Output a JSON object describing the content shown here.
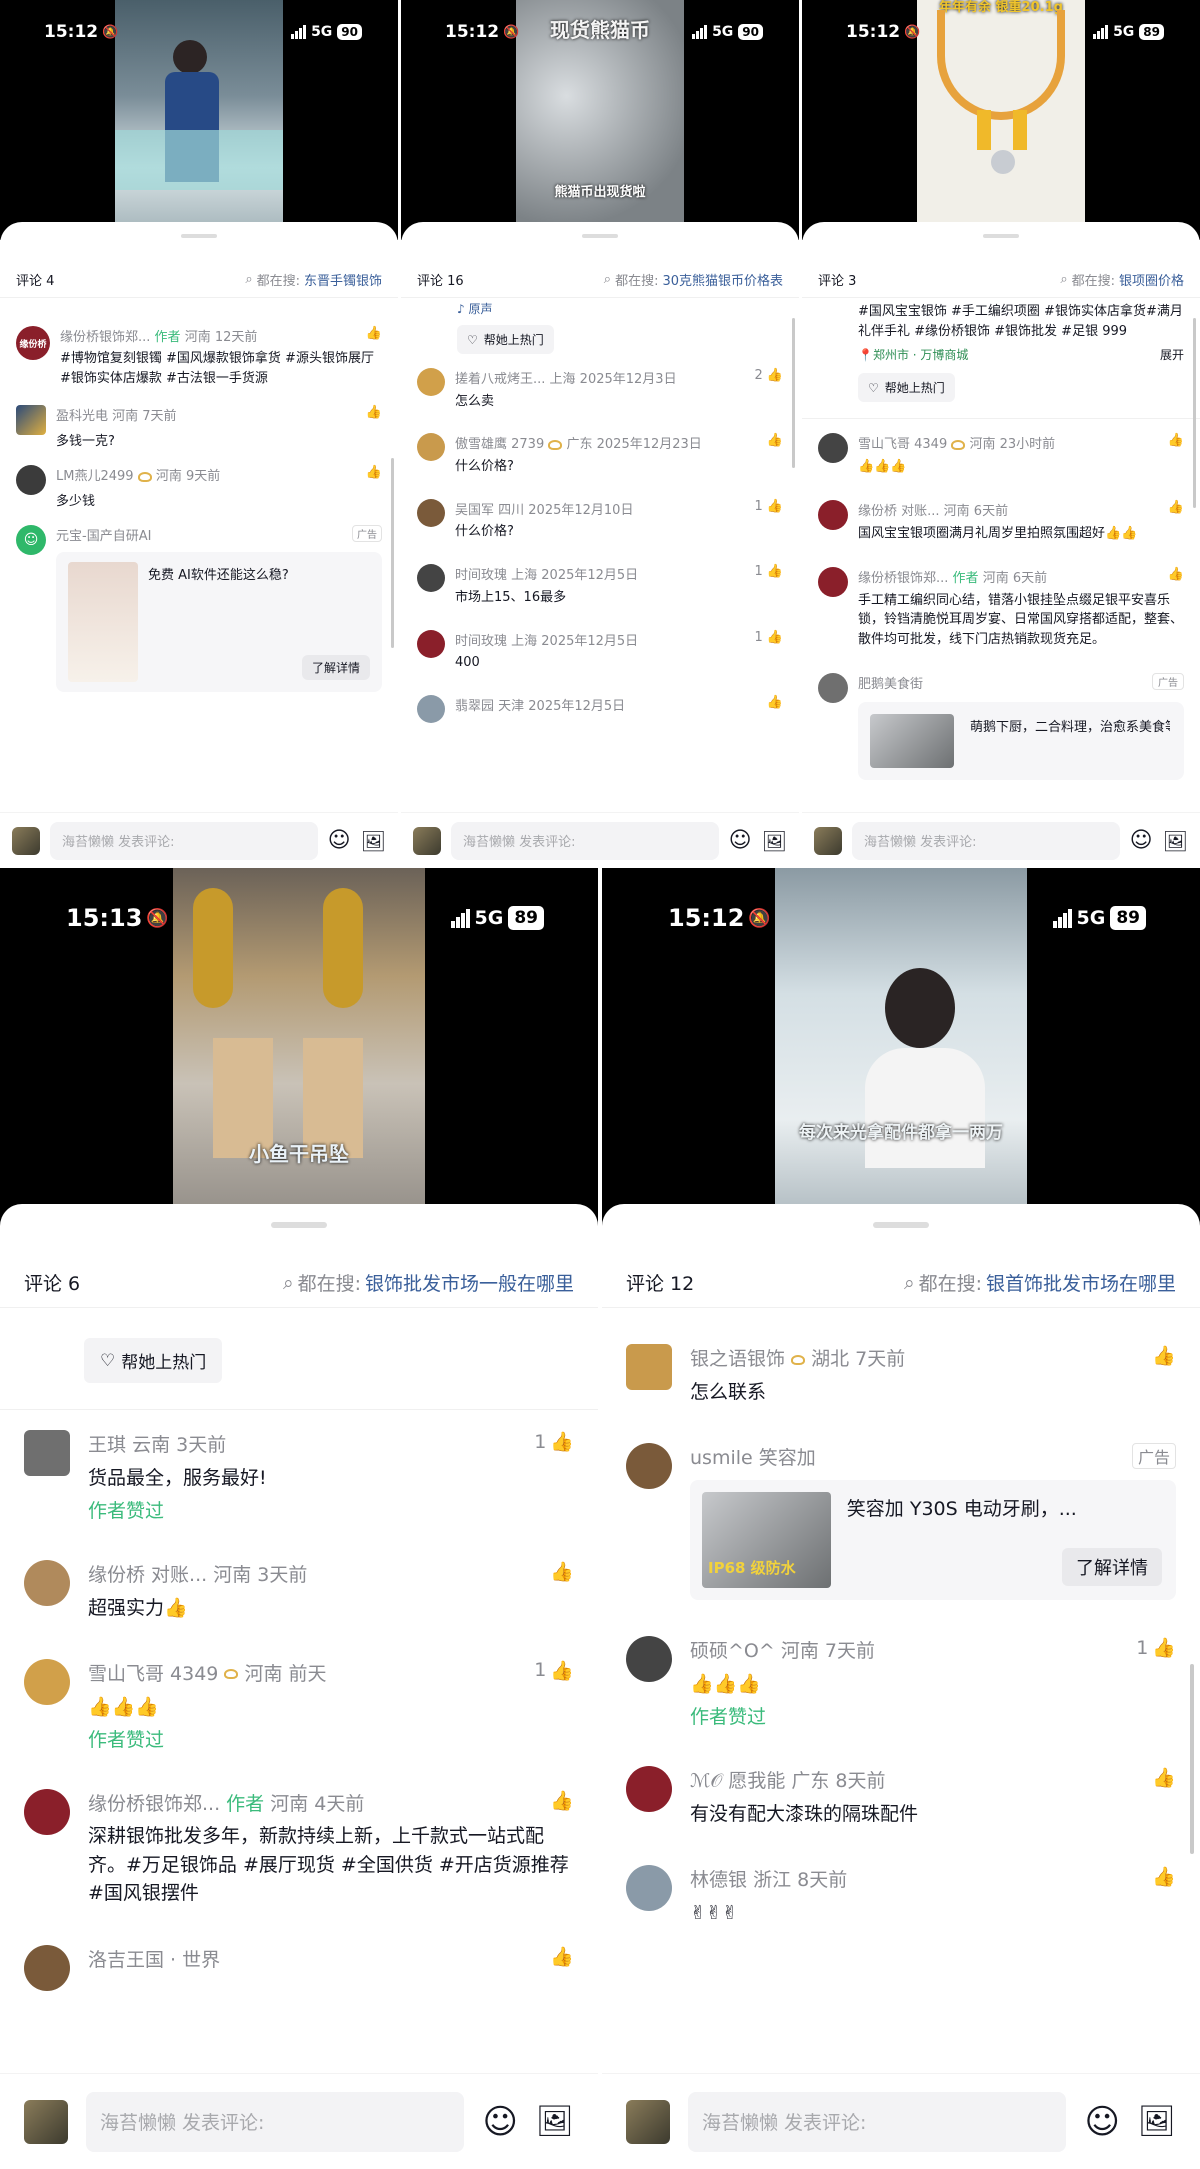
{
  "panels": [
    {
      "time": "15:12",
      "network": "5G",
      "battery": "90",
      "video_caption": "",
      "count": "评论 4",
      "search_prefix": "都在搜:",
      "search_term": "东晋手镯银饰",
      "items": [
        {
          "kind": "comment",
          "name": "缘份桥银饰郑...",
          "author_tag": "作者",
          "meta": "河南 12天前",
          "text": "#博物馆复刻银镯 #国风爆款银饰拿货 #源头银饰展厅 #银饰实体店爆款 #古法银一手货源",
          "likes": "",
          "liked_by": ""
        },
        {
          "kind": "comment",
          "name": "盈科光电",
          "author_tag": "",
          "meta": "河南 7天前",
          "text": "多钱一克?",
          "likes": "",
          "liked_by": ""
        },
        {
          "kind": "comment",
          "name": "LM燕儿2499",
          "author_tag": "",
          "meta": "河南 9天前",
          "text": "多少钱",
          "likes": "",
          "liked_by": ""
        },
        {
          "kind": "ad",
          "name": "元宝-国产自研AI",
          "ad_label": "广告",
          "title": "免费 AI软件还能这么稳?",
          "button": "了解详情"
        }
      ],
      "input_placeholder": "海苔懒懒 发表评论:"
    },
    {
      "time": "15:12",
      "network": "5G",
      "battery": "90",
      "video_title": "现货熊猫币",
      "video_caption": "熊猫币出现货啦",
      "count": "评论 16",
      "search_prefix": "都在搜:",
      "search_term": "30克熊猫银币价格表",
      "top_note": "原声",
      "hot_label": "帮她上热门",
      "items": [
        {
          "kind": "comment",
          "name": "搓着八戒烤王...",
          "author_tag": "",
          "meta": "上海 2025年12月3日",
          "text": "怎么卖",
          "likes": "2",
          "liked_by": ""
        },
        {
          "kind": "comment",
          "name": "傲雪雄鹰 2739",
          "author_tag": "",
          "meta": "广东 2025年12月23日",
          "text": "什么价格?",
          "likes": "",
          "liked_by": ""
        },
        {
          "kind": "comment",
          "name": "吴国军",
          "author_tag": "",
          "meta": "四川 2025年12月10日",
          "text": "什么价格?",
          "likes": "1",
          "liked_by": ""
        },
        {
          "kind": "comment",
          "name": "时间玫瑰",
          "author_tag": "",
          "meta": "上海 2025年12月5日",
          "text": "市场上15、16最多",
          "likes": "1",
          "liked_by": ""
        },
        {
          "kind": "comment",
          "name": "时间玫瑰",
          "author_tag": "",
          "meta": "上海 2025年12月5日",
          "text": "400",
          "likes": "1",
          "liked_by": ""
        },
        {
          "kind": "comment",
          "name": "翡翠园",
          "author_tag": "",
          "meta": "天津 2025年12月5日",
          "text": "",
          "likes": "",
          "liked_by": ""
        }
      ],
      "input_placeholder": "海苔懒懒 发表评论:"
    },
    {
      "time": "15:12",
      "network": "5G",
      "battery": "89",
      "video_title": "年年有余 银重20.1g",
      "video_caption": "",
      "count": "评论 3",
      "search_prefix": "都在搜:",
      "search_term": "银项圈价格",
      "top_text": "#国风宝宝银饰 #手工编织项圈 #银饰实体店拿货#满月礼伴手礼 #缘份桥银饰 #银饰批发 #足银 999",
      "location": "郑州市 · 万博商城",
      "expand": "展开",
      "hot_label": "帮她上热门",
      "items": [
        {
          "kind": "comment",
          "name": "雪山飞哥 4349",
          "author_tag": "",
          "meta": "河南 23小时前",
          "text": "👍👍👍",
          "likes": "",
          "liked_by": ""
        },
        {
          "kind": "comment",
          "name": "缘份桥 对账...",
          "author_tag": "",
          "meta": "河南 6天前",
          "text": "国风宝宝银项圈满月礼周岁里拍照氛围超好👍👍",
          "likes": "",
          "liked_by": ""
        },
        {
          "kind": "comment",
          "name": "缘份桥银饰郑...",
          "author_tag": "作者",
          "meta": "河南 6天前",
          "text": "手工精工编织同心结，错落小银挂坠点缀足银平安喜乐锁，铃铛清脆悦耳周岁宴、日常国风穿搭都适配，整套、散件均可批发，线下门店热销款现货充足。",
          "likes": "",
          "liked_by": ""
        },
        {
          "kind": "ad",
          "name": "肥鹅美食街",
          "ad_label": "广告",
          "title": "萌鹅下厨，二合料理，治愈系美食等",
          "button": ""
        }
      ],
      "input_placeholder": "海苔懒懒 发表评论:"
    },
    {
      "time": "15:13",
      "network": "5G",
      "battery": "89",
      "video_caption": "小鱼干吊坠",
      "count": "评论 6",
      "search_prefix": "都在搜:",
      "search_term": "银饰批发市场一般在哪里",
      "hot_label": "帮她上热门",
      "items": [
        {
          "kind": "comment",
          "name": "王琪",
          "author_tag": "",
          "meta": "云南 3天前",
          "text": "货品最全，服务最好!",
          "likes": "1",
          "liked_by": "作者赞过"
        },
        {
          "kind": "comment",
          "name": "缘份桥 对账...",
          "author_tag": "",
          "meta": "河南 3天前",
          "text": "超强实力👍",
          "likes": "",
          "liked_by": ""
        },
        {
          "kind": "comment",
          "name": "雪山飞哥 4349",
          "author_tag": "",
          "meta": "河南 前天",
          "text": "👍👍👍",
          "likes": "1",
          "liked_by": "作者赞过"
        },
        {
          "kind": "comment",
          "name": "缘份桥银饰郑...",
          "author_tag": "作者",
          "meta": "河南 4天前",
          "text": "深耕银饰批发多年，新款持续上新，上千款式一站式配齐。#万足银饰品 #展厅现货 #全国供货 #开店货源推荐 #国风银摆件",
          "likes": "",
          "liked_by": ""
        },
        {
          "kind": "comment",
          "name": "洛吉王国 · 世界",
          "author_tag": "",
          "meta": "",
          "text": "",
          "likes": "",
          "liked_by": ""
        }
      ],
      "input_placeholder": "海苔懒懒 发表评论:"
    },
    {
      "time": "15:12",
      "network": "5G",
      "battery": "89",
      "video_caption": "每次来光拿配件都拿一两万",
      "count": "评论 12",
      "search_prefix": "都在搜:",
      "search_term": "银首饰批发市场在哪里",
      "items": [
        {
          "kind": "comment",
          "name": "银之语银饰",
          "author_tag": "",
          "meta": "湖北 7天前",
          "text": "怎么联系",
          "likes": "",
          "liked_by": ""
        },
        {
          "kind": "ad",
          "name": "usmile 笑容加",
          "ad_label": "广告",
          "title": "笑容加 Y30S 电动牙刷，...",
          "button": "了解详情",
          "badge": "IP68 级防水"
        },
        {
          "kind": "comment",
          "name": "硕硕^O^",
          "author_tag": "",
          "meta": "河南 7天前",
          "text": "👍👍👍",
          "likes": "1",
          "liked_by": "作者赞过"
        },
        {
          "kind": "comment",
          "name": "ℳ𝒪 愿我能",
          "author_tag": "",
          "meta": "广东 8天前",
          "text": "有没有配大漆珠的隔珠配件",
          "likes": "",
          "liked_by": ""
        },
        {
          "kind": "comment",
          "name": "林德银",
          "author_tag": "",
          "meta": "浙江 8天前",
          "text": "✌✌✌",
          "likes": "",
          "liked_by": ""
        }
      ],
      "input_placeholder": "海苔懒懒 发表评论:"
    }
  ],
  "icons": {
    "like": "thumb-up-icon",
    "search": "search-icon",
    "emoji": "emoji-icon",
    "image": "image-icon",
    "heart": "heart-outline-icon"
  }
}
